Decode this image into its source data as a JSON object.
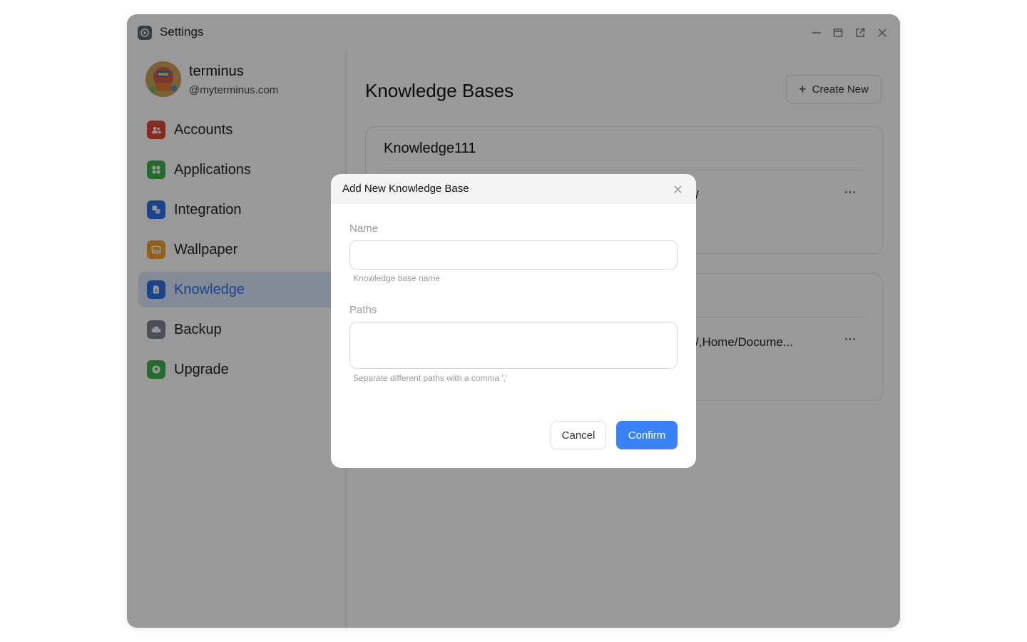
{
  "window": {
    "title": "Settings"
  },
  "user": {
    "name": "terminus",
    "domain": "@myterminus.com"
  },
  "sidebar": {
    "items": [
      {
        "label": "Accounts",
        "icon": "accounts-icon",
        "color": "#e0463a",
        "active": false
      },
      {
        "label": "Applications",
        "icon": "applications-icon",
        "color": "#3fb34f",
        "active": false
      },
      {
        "label": "Integration",
        "icon": "integration-icon",
        "color": "#2f6fe6",
        "active": false
      },
      {
        "label": "Wallpaper",
        "icon": "wallpaper-icon",
        "color": "#f0a32b",
        "active": false
      },
      {
        "label": "Knowledge",
        "icon": "knowledge-icon",
        "color": "#2f6fe6",
        "active": true
      },
      {
        "label": "Backup",
        "icon": "backup-icon",
        "color": "#7d8591",
        "active": false
      },
      {
        "label": "Upgrade",
        "icon": "upgrade-icon",
        "color": "#3fb34f",
        "active": false
      }
    ]
  },
  "main": {
    "title": "Knowledge Bases",
    "create_label": "Create New",
    "cards": [
      {
        "name": "Knowledge111",
        "path": "/",
        "more": "···"
      },
      {
        "name": "",
        "path": "/,Home/Docume...",
        "more": "···"
      }
    ]
  },
  "dialog": {
    "title": "Add New Knowledge Base",
    "name_label": "Name",
    "name_value": "",
    "name_hint": "Knowledge base name",
    "paths_label": "Paths",
    "paths_value": "",
    "paths_hint": "Separate different paths with a comma ','",
    "cancel_label": "Cancel",
    "confirm_label": "Confirm"
  },
  "colors": {
    "accent": "#3b82f6",
    "active_bg": "#dbe8fe",
    "active_text": "#2f6fe6"
  }
}
